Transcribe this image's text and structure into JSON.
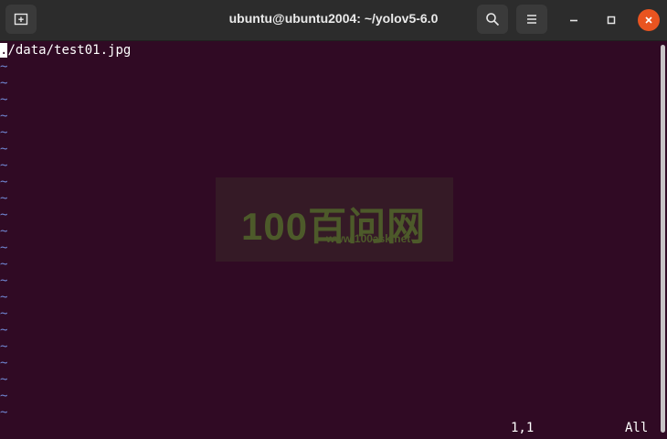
{
  "window": {
    "title": "ubuntu@ubuntu2004: ~/yolov5-6.0",
    "buttons": {
      "new_tab_icon": "new-tab-icon",
      "search_icon": "search-icon",
      "menu_icon": "hamburger-menu-icon",
      "minimize_icon": "minimize-icon",
      "maximize_icon": "maximize-icon",
      "close_icon": "close-icon"
    },
    "close_color": "#e95420"
  },
  "terminal": {
    "cursor_char": ".",
    "first_line_rest": "/data/test01.jpg",
    "tilde_char": "~",
    "tilde_count": 22,
    "ruler": "1,1",
    "position": "All",
    "background": "#300a24",
    "tilde_color": "#6f86d1"
  },
  "watermark": {
    "logo_text": "100百问网",
    "url": "www.100ask.net"
  }
}
